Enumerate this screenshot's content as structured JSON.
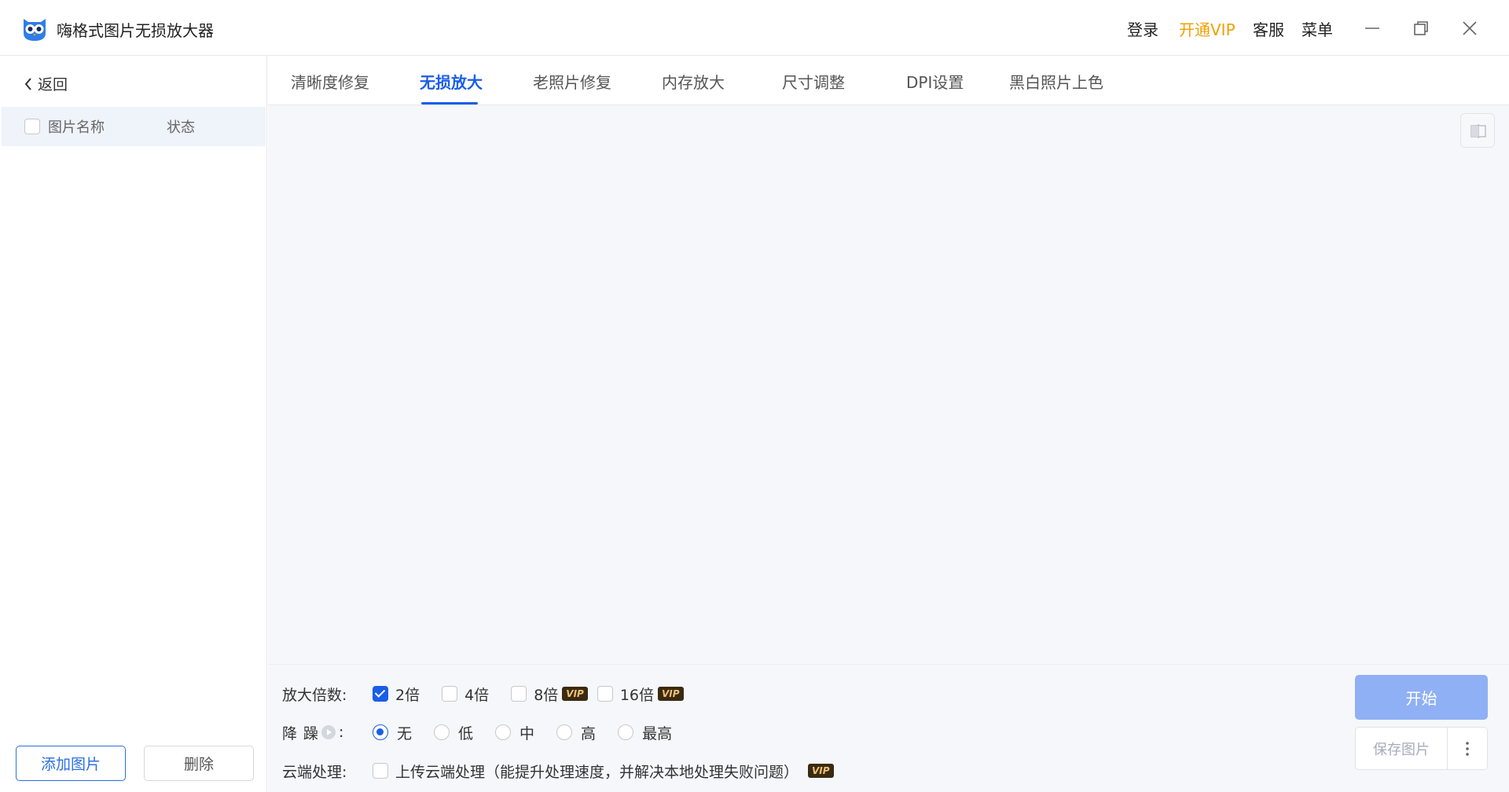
{
  "app": {
    "title": "嗨格式图片无损放大器",
    "icon": "owl-logo-icon"
  },
  "titlebar": {
    "login": "登录",
    "vip": "开通VIP",
    "service": "客服",
    "menu": "菜单"
  },
  "left": {
    "back": "返回",
    "col_name": "图片名称",
    "col_status": "状态",
    "add_button": "添加图片",
    "delete_button": "删除"
  },
  "tabs": [
    {
      "label": "清晰度修复"
    },
    {
      "label": "无损放大"
    },
    {
      "label": "老照片修复"
    },
    {
      "label": "内存放大"
    },
    {
      "label": "尺寸调整"
    },
    {
      "label": "DPI设置"
    },
    {
      "label": "黑白照片上色"
    }
  ],
  "active_tab": "无损放大",
  "controls": {
    "scale_label": "放大倍数:",
    "scale_options": [
      {
        "label": "2倍",
        "checked": true,
        "vip": false
      },
      {
        "label": "4倍",
        "checked": false,
        "vip": false
      },
      {
        "label": "8倍",
        "checked": false,
        "vip": true
      },
      {
        "label": "16倍",
        "checked": false,
        "vip": true
      }
    ],
    "denoise_label_1": "降",
    "denoise_label_2": "躁",
    "denoise_colon": ":",
    "denoise_options": [
      {
        "label": "无",
        "checked": true
      },
      {
        "label": "低",
        "checked": false
      },
      {
        "label": "中",
        "checked": false
      },
      {
        "label": "高",
        "checked": false
      },
      {
        "label": "最高",
        "checked": false
      }
    ],
    "cloud_label": "云端处理:",
    "cloud_option": "上传云端处理（能提升处理速度，并解决本地处理失败问题）",
    "vip_badge": "VIP"
  },
  "actions": {
    "start": "开始",
    "save": "保存图片"
  },
  "colors": {
    "accent": "#1a5ee8",
    "vip": "#f0a000",
    "start_button": "#8fb0f4"
  }
}
